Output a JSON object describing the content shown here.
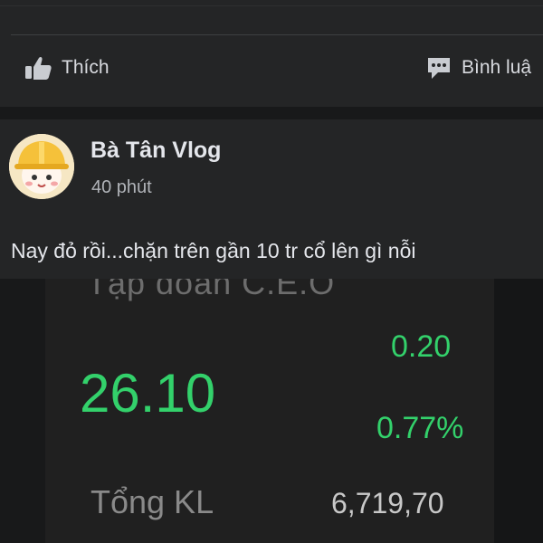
{
  "actions": {
    "like_label": "Thích",
    "comment_label": "Bình luậ"
  },
  "post": {
    "author": "Bà Tân Vlog",
    "time": "40 phút",
    "text": "Nay đỏ rồi...chặn trên gần 10 tr cổ lên gì nỗi"
  },
  "photo": {
    "company": "Tập đoàn C.E.O",
    "price": "26.10",
    "change": "0.20",
    "change_pct": "0.77%",
    "volume_label": "Tổng KL",
    "volume_value": "6,719,70",
    "accent_color": "#33d16b"
  }
}
